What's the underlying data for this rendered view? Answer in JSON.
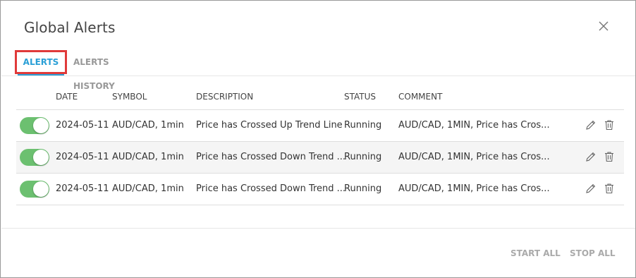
{
  "dialog": {
    "title": "Global Alerts",
    "close_icon": "close-icon"
  },
  "tabs": [
    {
      "label": "ALERTS",
      "active": true
    },
    {
      "label": "ALERTS HISTORY",
      "active": false
    }
  ],
  "table": {
    "headers": {
      "date": "DATE",
      "symbol": "SYMBOL",
      "description": "DESCRIPTION",
      "status": "STATUS",
      "comment": "COMMENT"
    },
    "rows": [
      {
        "enabled": true,
        "date": "2024-05-11",
        "symbol": "AUD/CAD, 1min",
        "description": "Price has Crossed Up Trend Line",
        "status": "Running",
        "comment": "AUD/CAD, 1MIN, Price has Cros..."
      },
      {
        "enabled": true,
        "date": "2024-05-11",
        "symbol": "AUD/CAD, 1min",
        "description": "Price has Crossed Down Trend ...",
        "status": "Running",
        "comment": "AUD/CAD, 1MIN, Price has Cros..."
      },
      {
        "enabled": true,
        "date": "2024-05-11",
        "symbol": "AUD/CAD, 1min",
        "description": "Price has Crossed Down Trend ...",
        "status": "Running",
        "comment": "AUD/CAD, 1MIN, Price has Cros..."
      }
    ],
    "row_icons": [
      "pencil-icon",
      "trash-icon"
    ]
  },
  "footer": {
    "start_all": "START ALL",
    "stop_all": "STOP ALL"
  },
  "colors": {
    "accent": "#2a9fd6",
    "toggle_on": "#6cc070",
    "highlight_border": "#e03a3a"
  }
}
